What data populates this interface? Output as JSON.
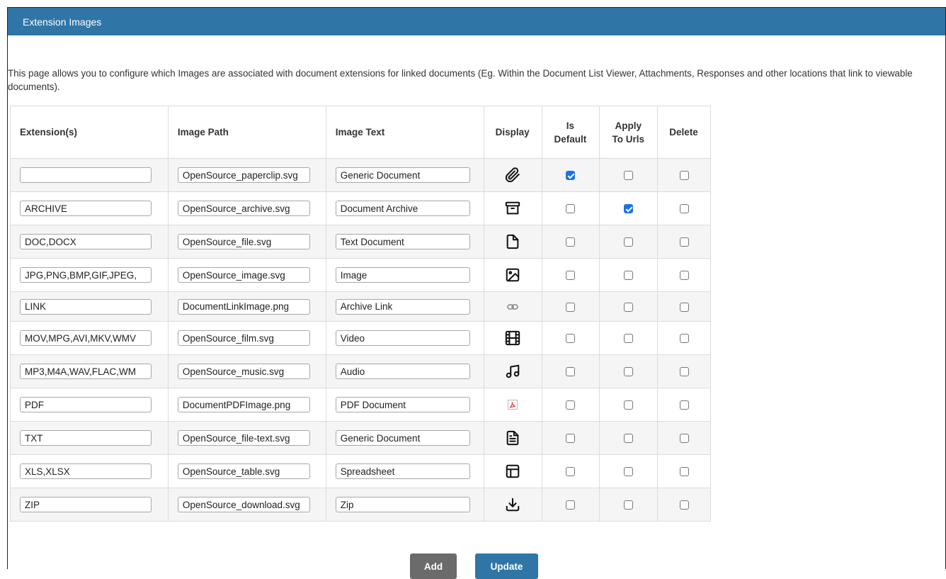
{
  "header": {
    "title": "Extension Images"
  },
  "intro": "This page allows you to configure which Images are associated with document extensions for linked documents (Eg. Within the Document List Viewer, Attachments, Responses and other locations that link to viewable documents).",
  "columns": {
    "extensions": "Extension(s)",
    "image_path": "Image Path",
    "image_text": "Image Text",
    "display": "Display",
    "is_default_1": "Is",
    "is_default_2": "Default",
    "apply_urls_1": "Apply",
    "apply_urls_2": "To Urls",
    "delete": "Delete"
  },
  "rows": [
    {
      "ext": "",
      "path": "OpenSource_paperclip.svg",
      "text": "Generic Document",
      "icon": "paperclip-icon",
      "is_default": true,
      "apply_urls": false,
      "delete": false
    },
    {
      "ext": "ARCHIVE",
      "path": "OpenSource_archive.svg",
      "text": "Document Archive",
      "icon": "archive-icon",
      "is_default": false,
      "apply_urls": true,
      "delete": false
    },
    {
      "ext": "DOC,DOCX",
      "path": "OpenSource_file.svg",
      "text": "Text Document",
      "icon": "file-icon",
      "is_default": false,
      "apply_urls": false,
      "delete": false
    },
    {
      "ext": "JPG,PNG,BMP,GIF,JPEG,",
      "path": "OpenSource_image.svg",
      "text": "Image",
      "icon": "image-icon",
      "is_default": false,
      "apply_urls": false,
      "delete": false
    },
    {
      "ext": "LINK",
      "path": "DocumentLinkImage.png",
      "text": "Archive Link",
      "icon": "link-icon",
      "is_default": false,
      "apply_urls": false,
      "delete": false
    },
    {
      "ext": "MOV,MPG,AVI,MKV,WMV",
      "path": "OpenSource_film.svg",
      "text": "Video",
      "icon": "film-icon",
      "is_default": false,
      "apply_urls": false,
      "delete": false
    },
    {
      "ext": "MP3,M4A,WAV,FLAC,WM",
      "path": "OpenSource_music.svg",
      "text": "Audio",
      "icon": "music-icon",
      "is_default": false,
      "apply_urls": false,
      "delete": false
    },
    {
      "ext": "PDF",
      "path": "DocumentPDFImage.png",
      "text": "PDF Document",
      "icon": "pdf-icon",
      "is_default": false,
      "apply_urls": false,
      "delete": false
    },
    {
      "ext": "TXT",
      "path": "OpenSource_file-text.svg",
      "text": "Generic Document",
      "icon": "file-text-icon",
      "is_default": false,
      "apply_urls": false,
      "delete": false
    },
    {
      "ext": "XLS,XLSX",
      "path": "OpenSource_table.svg",
      "text": "Spreadsheet",
      "icon": "table-icon",
      "is_default": false,
      "apply_urls": false,
      "delete": false
    },
    {
      "ext": "ZIP",
      "path": "OpenSource_download.svg",
      "text": "Zip",
      "icon": "download-icon",
      "is_default": false,
      "apply_urls": false,
      "delete": false
    }
  ],
  "buttons": {
    "add": "Add",
    "update": "Update"
  },
  "colors": {
    "header_bg": "#2f76a7",
    "checkbox_checked": "#1a73e8",
    "add_bg": "#6b6b6b",
    "update_bg": "#2f76a7",
    "pdf_icon": "#d9534f"
  }
}
